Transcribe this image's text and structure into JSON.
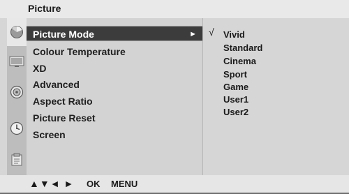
{
  "header": {
    "title": "Picture"
  },
  "icons": [
    {
      "name": "picture-icon",
      "active": true
    },
    {
      "name": "screen-icon",
      "active": false
    },
    {
      "name": "sound-icon",
      "active": false
    },
    {
      "name": "time-icon",
      "active": false
    },
    {
      "name": "option-icon",
      "active": false
    }
  ],
  "menu": {
    "items": [
      {
        "label": "Picture Mode",
        "selected": true,
        "has_arrow": true,
        "arrow": "►"
      },
      {
        "label": "Colour Temperature"
      },
      {
        "label": "XD"
      },
      {
        "label": "Advanced"
      },
      {
        "label": "Aspect Ratio"
      },
      {
        "label": "Picture Reset"
      },
      {
        "label": "Screen"
      }
    ]
  },
  "options": {
    "check_mark": "√",
    "items": [
      "Vivid",
      "Standard",
      "Cinema",
      "Sport",
      "Game",
      "User1",
      "User2"
    ],
    "selected_index": 0
  },
  "footer": {
    "nav_arrows": "▲▼◄ ►",
    "ok_label": "OK",
    "menu_label": "MENU"
  },
  "colors": {
    "selected_bg": "#3c3c3c",
    "panel_bg": "#d6d6d6",
    "rail_bg": "#bdbdbd"
  }
}
